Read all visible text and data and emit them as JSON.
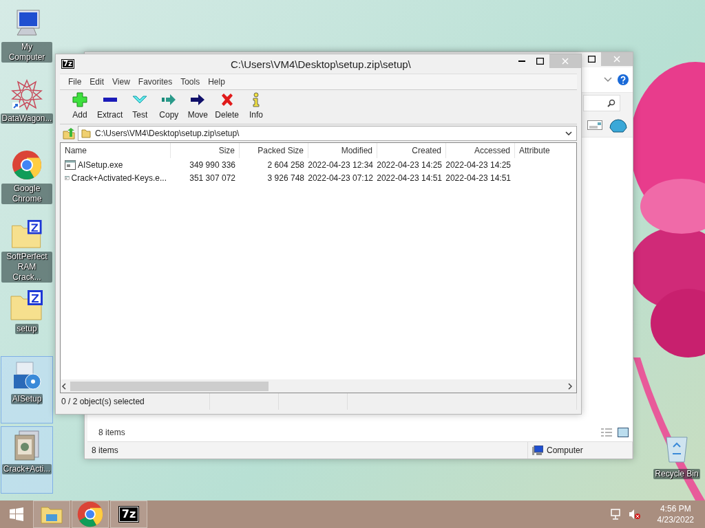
{
  "desktop_icons": [
    {
      "label": "My Computer",
      "kind": "computer",
      "selected": false
    },
    {
      "label": "DataWagon...",
      "kind": "star",
      "selected": false
    },
    {
      "label": "Google Chrome",
      "kind": "chrome",
      "selected": false
    },
    {
      "label": "SoftPerfect RAM Crack...",
      "kind": "archive",
      "selected": false
    },
    {
      "label": "setup",
      "kind": "archive",
      "selected": false
    },
    {
      "label": "AISetup",
      "kind": "installer",
      "selected": true
    },
    {
      "label": "Crack+Acti...",
      "kind": "package",
      "selected": true
    }
  ],
  "explorer_window": {
    "items_count": "8 items",
    "status": {
      "count": "8 items",
      "location": "Computer"
    }
  },
  "archive_window": {
    "logo": "7z",
    "title": "C:\\Users\\VM4\\Desktop\\setup.zip\\setup\\",
    "menu": [
      "File",
      "Edit",
      "View",
      "Favorites",
      "Tools",
      "Help"
    ],
    "toolbar": [
      {
        "label": "Add",
        "kind": "add"
      },
      {
        "label": "Extract",
        "kind": "extract"
      },
      {
        "label": "Test",
        "kind": "test"
      },
      {
        "label": "Copy",
        "kind": "copy"
      },
      {
        "label": "Move",
        "kind": "move"
      },
      {
        "label": "Delete",
        "kind": "delete"
      },
      {
        "label": "Info",
        "kind": "info"
      }
    ],
    "address": "C:\\Users\\VM4\\Desktop\\setup.zip\\setup\\",
    "columns": [
      "Name",
      "Size",
      "Packed Size",
      "Modified",
      "Created",
      "Accessed",
      "Attribute"
    ],
    "rows": [
      {
        "selected": false,
        "cells": [
          "AISetup.exe",
          "349 990 336",
          "2 604 258",
          "2022-04-23 12:34",
          "2022-04-23 14:25",
          "2022-04-23 14:25"
        ]
      },
      {
        "selected": false,
        "cells": [
          "Crack+Activated-Keys.e...",
          "351 307 072",
          "3 926 748",
          "2022-04-23 07:12",
          "2022-04-23 14:51",
          "2022-04-23 14:51"
        ]
      }
    ],
    "status": "0 / 2 object(s) selected"
  },
  "taskbar": {
    "pinned": [
      {
        "kind": "explorer"
      },
      {
        "kind": "chrome"
      },
      {
        "kind": "sevenzip",
        "label": "7z"
      }
    ],
    "time": "4:56 PM",
    "date": "4/23/2022"
  },
  "recycle_bin": {
    "label": "Recycle Bin"
  }
}
